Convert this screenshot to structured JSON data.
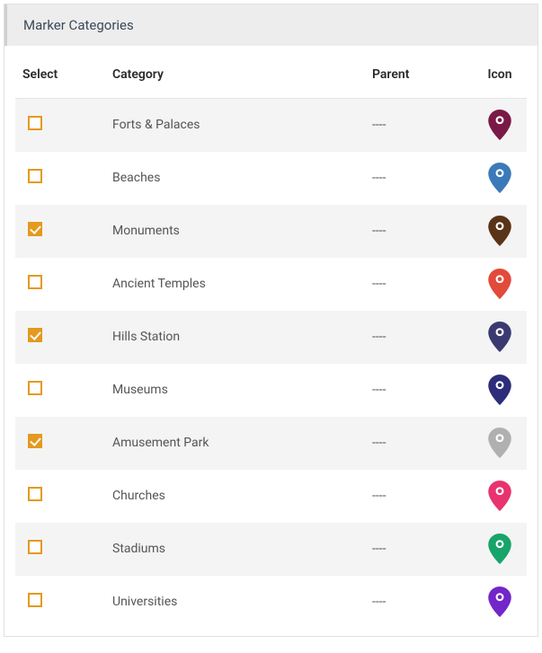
{
  "panel": {
    "title": "Marker Categories"
  },
  "table": {
    "headers": {
      "select": "Select",
      "category": "Category",
      "parent": "Parent",
      "icon": "Icon"
    },
    "empty_parent": "----",
    "rows": [
      {
        "checked": false,
        "category": "Forts & Palaces",
        "parent": "----",
        "icon_color": "#7a1946"
      },
      {
        "checked": false,
        "category": "Beaches",
        "parent": "----",
        "icon_color": "#3b7ab8"
      },
      {
        "checked": true,
        "category": "Monuments",
        "parent": "----",
        "icon_color": "#5a3418"
      },
      {
        "checked": false,
        "category": "Ancient Temples",
        "parent": "----",
        "icon_color": "#e24a3b"
      },
      {
        "checked": true,
        "category": "Hills Station",
        "parent": "----",
        "icon_color": "#3b3a70"
      },
      {
        "checked": false,
        "category": "Museums",
        "parent": "----",
        "icon_color": "#2e2d7a"
      },
      {
        "checked": true,
        "category": "Amusement Park",
        "parent": "----",
        "icon_color": "#b0b0b0"
      },
      {
        "checked": false,
        "category": "Churches",
        "parent": "----",
        "icon_color": "#e8336f"
      },
      {
        "checked": false,
        "category": "Stadiums",
        "parent": "----",
        "icon_color": "#17a46a"
      },
      {
        "checked": false,
        "category": "Universities",
        "parent": "----",
        "icon_color": "#7326c9"
      }
    ]
  }
}
